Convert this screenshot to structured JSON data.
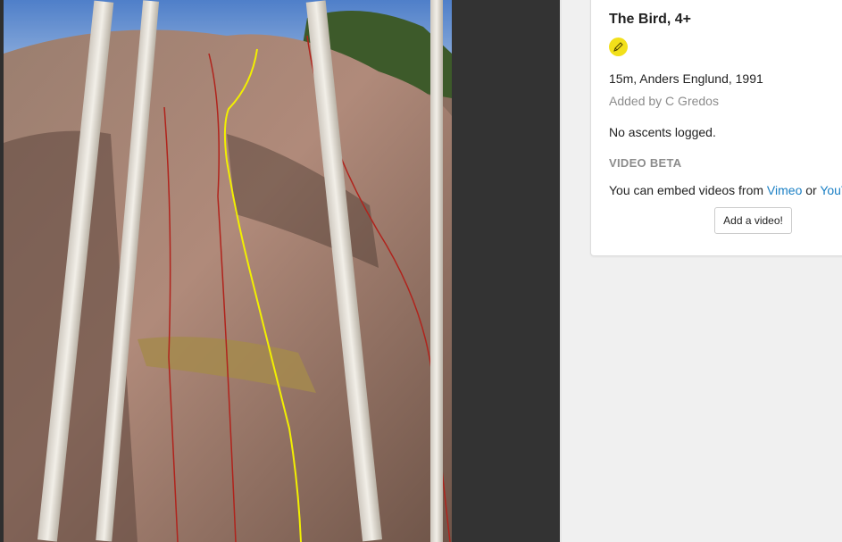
{
  "photo": {
    "description_icon": "route-photo-image",
    "selected_route_color": "#f2f000",
    "other_route_color": "#b0231c"
  },
  "route": {
    "title": "The Bird, 4+",
    "grade_icon": "grade-badge-icon",
    "grade_color": "#f2e01a",
    "meta": "15m, Anders Englund, 1991",
    "added_by": "Added by C Gredos",
    "ascents": "No ascents logged."
  },
  "video_beta": {
    "heading": "VIDEO BETA",
    "embed_prefix": "You can embed videos from",
    "vimeo_label": "Vimeo",
    "or_label": "or",
    "youtube_label": "YouTube",
    "button_label": "Add a video!"
  }
}
